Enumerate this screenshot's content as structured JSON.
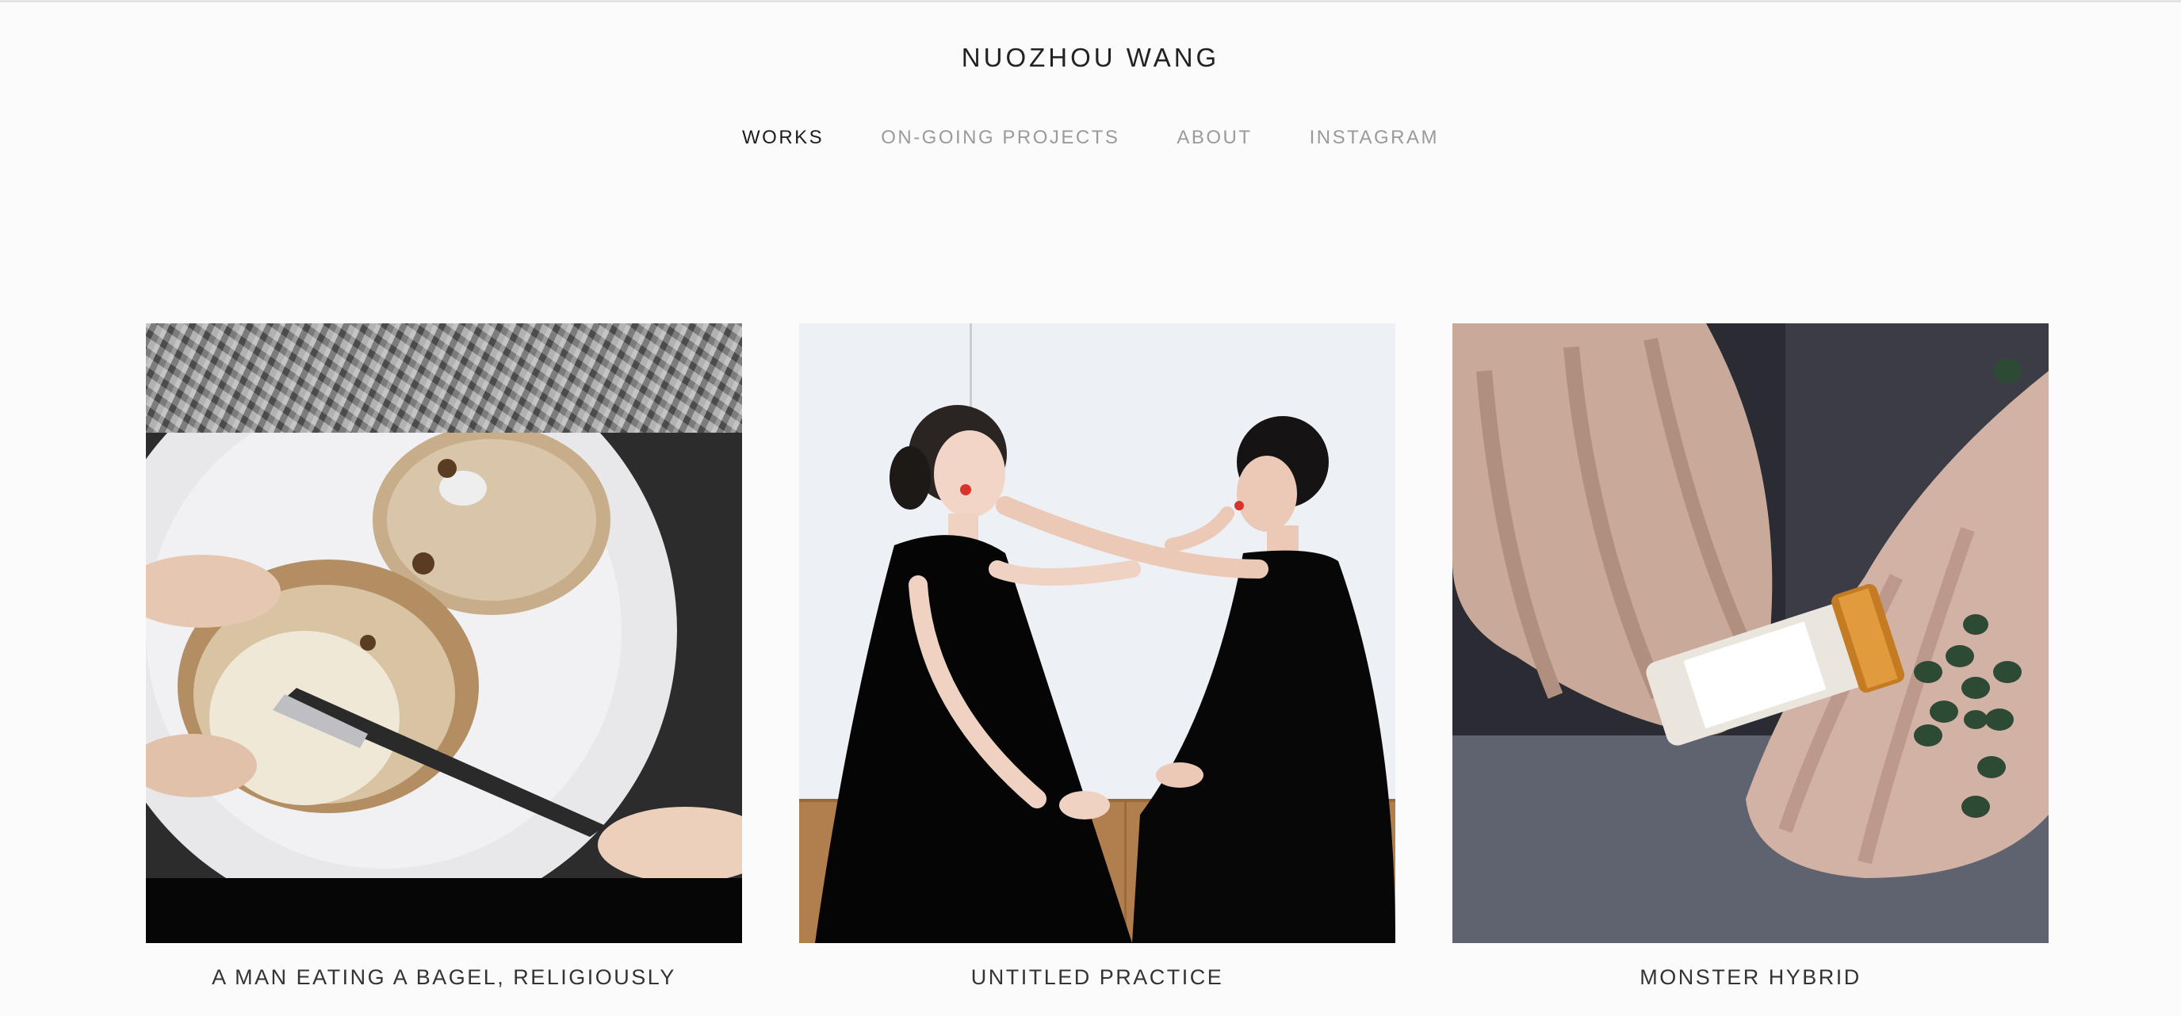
{
  "site": {
    "title": "NUOZHOU WANG"
  },
  "nav": {
    "items": [
      {
        "label": "WORKS",
        "active": true
      },
      {
        "label": "ON-GOING PROJECTS",
        "active": false
      },
      {
        "label": "ABOUT",
        "active": false
      },
      {
        "label": "INSTAGRAM",
        "active": false
      }
    ]
  },
  "works": [
    {
      "title": "A MAN EATING A BAGEL, RELIGIOUSLY"
    },
    {
      "title": "UNTITLED PRACTICE"
    },
    {
      "title": "MONSTER HYBRID"
    }
  ],
  "colors": {
    "background": "#fbfbfb",
    "nav_active": "#1c1c1c",
    "nav_inactive": "#9a9a9a"
  }
}
